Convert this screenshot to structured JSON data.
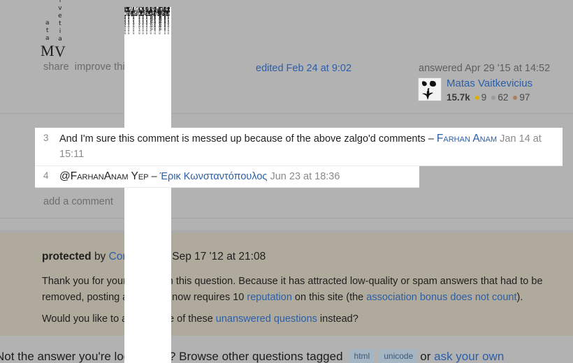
{
  "colors": {
    "page_bg": "#b2b2b2",
    "protected_bg": "#b0aa9c",
    "link": "#2b5ea8",
    "gold_badge": "#e0b000",
    "silver_badge": "#9a9a9a",
    "bronze_badge": "#ab8060",
    "comment_bg": "#ffffff"
  },
  "post_menu": {
    "share_label": "share",
    "improve_label": "improve this answer",
    "edited_label": "edited Feb 24 at 9:02"
  },
  "answered": {
    "when_label": "answered Apr 29 '15 at 14:52",
    "user_name": "Matas Vaitkevicius",
    "reputation": "15.7k",
    "gold_count": "9",
    "silver_count": "62",
    "bronze_count": "97",
    "avatar_name": "matas-vaitkevicius-avatar"
  },
  "overflow_text": {
    "vertical_name_left": [
      "a",
      "t",
      "a",
      "M"
    ],
    "vertical_name_right": [
      "i",
      "v",
      "e",
      "t",
      "i",
      "a",
      "V"
    ],
    "zalgo_column": "̡̢̛̗̘̙̜̝̞̟̠̩̪̫̬̭̮̯̰̱̲̳̹̺̻̼͇͈͉͍͎̀́̂̃̄̅̆̇̈̉̊̋̌̍̎̏̐̑̒̓̔̽̾̿̀́͂̓̈́͆͊͋͌̕̚ͅ͏͓͔͕͖͙͚͐͑͒͗͛ͣͤͥͦͧͨͩͪͫͬͭͮͯ͘͜͟͢͝͞͠͡Z̮̞̠͙͔ͅḀ̗̞͈̻̗Ḷ͙͎̯̹̞͓G̻Ȏ̭̗̮̾̈́͒͝ẗ̬́͛ͅo̙̔ͮ̇͑̚ ̩̘̦͖͈ị̶̧̨̳̫̭̟̲̹̀́̓̈́̉̂̆̊̋̌̍̎̏̐̑̒̓̔̽̾̿̀́͂̓̈́͆͊͋͌̚n̶̷̡̢̛̗̘̙̜̝̞̟̠̩̪̫̬̭̮̯̰̱̲̳̹̺̻̼͇͈͉͍͎͓͔͕͖͙͚v̸̧̨̛̗̘̙̜̝̞̟̠̩̪̫̬̭̮̯̰̱̲̳̹̺̻̼͇͈͉͍͎ớ̡̢̗̘̙̜̝̞̟̠̩̪̫̬̭̮̯̰̱̲̳̹̺̻̼͇͈͉͍͎̀́̂̃̄̅̆̇̈̉̊̋̌̍̎̏̐̑̒̓̔̽̾̿̀́͂̓̈́͆͊͋͌̕̚ͅk̶̷̡̢̛̗̘̙̜̝̞̟̠̩̪̫̬̭̮̯̰̱̲̳̹̺̻̼͇͈͉͍͎͓͔͕͖͙͚ḛ̸̢̛̗̘̙̜̝̞̟̠̩̪̫̬̭̮̯̰̱̲̳̹̺̻̼͇͈͉͍͎̀́̂̃̄̅̆̇̈̉̊̋̌̍̎̏̐̑̒̓̔̽̾̿̀́͂̓̈́͆͊͋͌̕̚ ̵̡̢̛̗̘̙̜̝̞̟̠̩̪̫̬̭̮̯̰̱̲̳̹̺̻̼͇͈͉͍͎̀́̂̃̄̅̆̇̈̉̊̋̌̍̎̏̐̑̒̓̔̽̾̿̀́͂̓̈́͆͊͋͌̕̚ͅt̶̷̡̢̛̗̘̙̜̝̞̟̠̩̪̫̬̭̮̯̰̱̲̳̹̺̻̼͇͈͉͍͎͓͔͕͖͙͚h̸̢̛̗̘̙̜̝̞̟̠̩̪̫̬̭̮̯̰̱̲̳̹̺̻̼͇͈͉͍͎̀́̂̃̄̅̆̇̈̉̊̋̌̍̎̏̐̑̒̓̔̽̾̿̀́͂̓̈́͆͊͋͌̕̚ḛ̵̡̢̛̗̘̙̜̝̞̟̠̩̪̫̬̭̮̯̰̱̲̳̹̺̻̼͇͈͉͍͎͓͔͕͖͙͚͐͑͒͗͛ͣͤͥͦͧͨͩͪͫͬͭͮͯ ̴̡̢̛̗̘̙̜̝̞̟̠̩̪̫̬̭̮̯̰̱̲̳̹̺̻̼͇͈͉͍͎̀́̂̃̄̅̆̇̈̉̊̋̌̍̎̏̐̑̒̓̔̽̾̿̀́͂̓̈́͆͊͋͌̕̚ͅh̶̷̡̢̛̗̘̙̜̝̞̟̠̩̪̫̬̭̮̯̰̱̲̳̹̺̻̼͇͈͉͍͎͓͔͕͖͙͚ḭ̸̢̛̗̘̙̜̝̞̟̠̩̪̫̬̭̮̯̰̱̲̳̹̺̻̼͇͈͉͍͎̀́̂̃̄̅̆̇̈̉̊̋̌̍̎̏̐̑̒̓̔̽̾̿̀́͂̓̈́͆͊͋͌̕̚v̵̡̢̛̗̘̙̜̝̞̟̠̩̪̫̬̭̮̯̰̱̲̳̹̺̻̼͇͈͉͍͎͓͔͕͖͙͚͐͑͒͗͛ͣͤͥͦͧͨͩͪͫͬͭͮͯḛ̴̡̢̛̗̘̙̜̝̞̟̠̩̪̫̬̭̮̯̰̱̲̳̹̺̻̼͇͈͉͍͎̀́̂̃̄̅̆̇̈̉̊̋̌̍̎̏̐̑̒̓̔̽̾̿̀́͂̓̈́͆͊͋͌̕̚ͅ-̶̷̡̢̛̗̘̙̜̝̞̟̠̩̪̫̬̭̮̯̰̱̲̳̹̺̻̼͇͈͉͍͎͓͔͕͖͙͚m̸̢̛̗̘̙̜̝̞̟̠̩̪̫̬̭̮̯̰̱̲̳̹̺̻̼͇͈͉͍͎̀́̂̃̄̅̆̇̈̉̊̋̌̍̎̏̐̑̒̓̔̽̾̿̀͂̓̈́͆͊͋͌̕̚ḭ̵̡̢̛̗̘̙̜̝̞̟̠̩̪̫̬̭̮̯̰̱̲̳̹̺̻̼͇͈͉͍͎͓͔͕͖͙͚͐͑͒͗͛ͣͤͥͦͧͨͩͪͫͬͭͮͯṇ̴̡̢̛̗̘̙̜̝̞̟̠̩̪̫̬̭̮̯̰̱̲̳̹̺̻̼͇͈͉͍͎̀́̂̃̄̅̆̇̈̉̊̋̌̍̎̏̐̑̒̓̔̽̾̿̀́͂̓̈́͆͊͋͌̕̚ͅd̶̷̡̢̛̗̘̙̜̝̞̟̠̩̪̫̬̭̮̯̰̱̲̳̹̺̻̼͇͈͉͍͎͓͔͕͖͙͚ ̸̢̛̗̘̙̜̝̞̟̠̩̪̫̬̭̮̯̰̱̲̳̹̺̻̼͇͈͉͍͎̀́̂̃̄̅̆̇̈̉̊̋̌̍̎̏̐̑̒̓̔̽̾̿̀͂̓̈́͆͊͋͌̕̚r̵̡̢̛̗̘̙̜̝̞̟̠̩̪̫̬̭̮̯̰̱̲̳̹̺̻̼͇͈͉͍͎͓͔͕͖͙͚͐͑͒͗͛ͣͤͥͦͧͨͩͪͫͬͭͮͯè̴̡̢̛̗̘̙̜̝̞̟̠̩̪̫̬̭̮̯̰̱̲̳̹̺̻̼͇͈͉͍͎́̂̃̄̅̆̇̈̉̊̋̌̍̎̏̐̑̒̓̔̽̾̿̀́͂̓̈́͆͊͋͌̕̚ͅp̶̷̡̢̛̗̘̙̜̝̞̟̠̩̪̫̬̭̮̯̰̱̲̳̹̺̻̼͇͈͉͍͎͓͔͕͖͙͚r̸̢̛̗̘̙̜̝̞̟̠̩̪̫̬̭̮̯̰̱̲̳̹̺̻̼͇͈͉͍͎̀́̂̃̄̅̆̇̈̉̊̋̌̍̎̏̐̑̒̓̔̽̾̿̀͂̓̈́͆͊͋͌̕̚e̵̡̢̛̗̘̙̜̝̞̟̠̩̪̫̬̭̮̯̰̱̲̳̹̺̻̼͇͈͉͍͎͓͔͕͖͙͚͐͑͒͗͛ͣͤͥͦͧͨͩͪͫͬͭͮͯs̴̡̢̛̗̘̙̜̝̞̟̠̩̪̫̬̭̮̯̰̱̲̳̹̺̻̼͇͈͉͍͎̀́̂̃̄̅̆̇̈̉̊̋̌̍̎̏̐̑̒̓̔̽̾̿̀́͂̓̈́͆͊͋͌̕̚ͅe̶̷̡̢̛̗̘̙̜̝̞̟̠̩̪̫̬̭̮̯̰̱̲̳̹̺̻̼͇͈͉͍͎͓͔͕͖͙͚ǹ̸̢̛̗̘̙̜̝̞̟̠̩̪̫̬̭̮̯̰̱̲̳̹̺̻̼͇͈͉͍͎́̂̃̄̅̆̇̈̉̊̋̌̍̎̏̐̑̒̓̔̽̾̿̀͂̓̈́͆͊͋͌̕̚ẗ̵̡̢̛̗̘̙̜̝̞̟̠̩̪̫̬̭̮̯̰̱̲̳̹̺̻̼͇͈͉͍͎͓͔͕͖͙͚͐͑͒͗͛ͣͤͥͦͧͨͩͪͫͬͭͮͯs̴̡̢̛̗̘̙̜̝̞̟̠̩̪̫̬̭̮̯̰̱̲̳̹̺̻̼͇͈͉͍͎̀́̂̃̄̅̆̇̈̉̊̋̌̍̎̏̐̑̒̓̔̽̾̿̀́͂̓̈́͆͊͋͌̕̚ͅ"
  },
  "comments": [
    {
      "score": "3",
      "text_before": "And I'm sure this comment is messed up because of the above zalgo'd comments",
      "dash": "–",
      "user": "Farhan Anam",
      "date": "Jan 14 at 15:11"
    },
    {
      "score": "4",
      "text_before": "@FarhanAnam Yep",
      "dash": "–",
      "user": "Έρικ Κωνσταντόπουλος",
      "date": "Jun 23 at 18:36"
    }
  ],
  "add_comment_label": "add a comment",
  "protected": {
    "title_bold": "protected",
    "title_by": "by",
    "community_link": "Community",
    "diamond": "♦",
    "title_date": "Sep 17 '12 at 21:08",
    "p1_a": "Thank you for your interest in this question. Because it has attracted low-quality or spam answers that had to be removed, posting an answer now requires 10 ",
    "p1_link1": "reputation",
    "p1_b": " on this site (the ",
    "p1_link2": "association bonus does not count",
    "p1_c": ").",
    "p2_a": "Would you like to answer one of these ",
    "p2_link": "unanswered questions",
    "p2_b": " instead?"
  },
  "bottom": {
    "prefix": "Not the answer you're looking for? Browse other questions tagged",
    "tags": [
      "html",
      "unicode"
    ],
    "middle": "or",
    "link": "ask your own"
  }
}
